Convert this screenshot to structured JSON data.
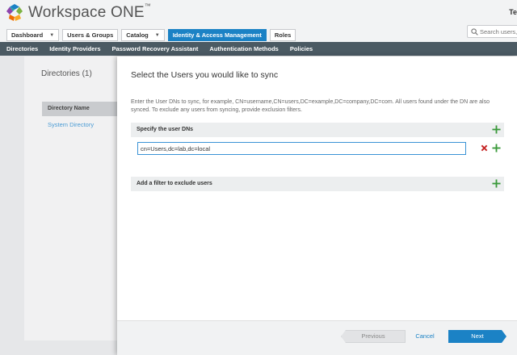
{
  "app": {
    "title": "Workspace ONE",
    "trademark": "™",
    "user_initial": "Te"
  },
  "tabs": [
    {
      "label": "Dashboard",
      "dropdown": true
    },
    {
      "label": "Users & Groups",
      "dropdown": false
    },
    {
      "label": "Catalog",
      "dropdown": true
    },
    {
      "label": "Identity & Access Management",
      "dropdown": false,
      "active": true
    },
    {
      "label": "Roles",
      "dropdown": false
    }
  ],
  "search": {
    "placeholder": "Search users, groups"
  },
  "subnav": [
    "Directories",
    "Identity Providers",
    "Password Recovery Assistant",
    "Authentication Methods",
    "Policies"
  ],
  "background": {
    "title": "Directories",
    "count": "(1)",
    "column_header": "Directory Name",
    "row": "System Directory"
  },
  "modal": {
    "title": "Select the Users you would like to sync",
    "description": "Enter the User DNs to sync, for example, CN=username,CN=users,DC=example,DC=company,DC=com. All users found under the DN are also synced. To exclude any users from syncing, provide exclusion filters.",
    "user_dns_label": "Specify the user DNs",
    "dn_value": "cn=Users,dc=lab,dc=local",
    "exclude_label": "Add a filter to exclude users"
  },
  "footer": {
    "previous": "Previous",
    "cancel": "Cancel",
    "next": "Next"
  },
  "colors": {
    "accent": "#1b82c5",
    "subnav": "#4b5a63",
    "add": "#3a9a3a",
    "remove": "#c62828"
  }
}
